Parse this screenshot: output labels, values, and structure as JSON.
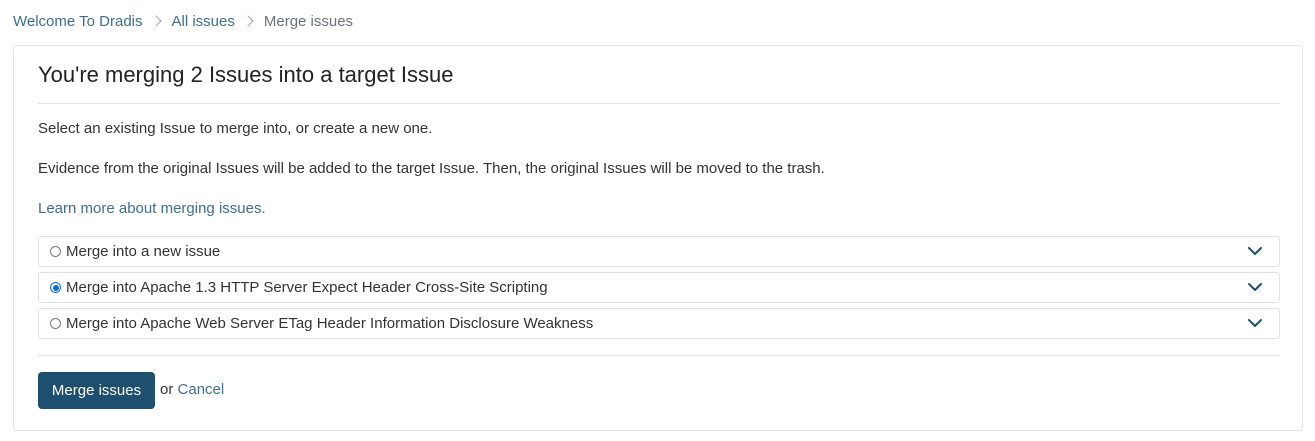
{
  "breadcrumb": {
    "items": [
      {
        "label": "Welcome To Dradis"
      },
      {
        "label": "All issues"
      }
    ],
    "current": "Merge issues"
  },
  "card": {
    "title": "You're merging 2 Issues into a target Issue",
    "instruction": "Select an existing Issue to merge into, or create a new one.",
    "evidence_note": "Evidence from the original Issues will be added to the target Issue. Then, the original Issues will be moved to the trash.",
    "learn_more_link": "Learn more about merging issues.",
    "options": [
      {
        "label": "Merge into a new issue",
        "selected": false
      },
      {
        "label": "Merge into Apache 1.3 HTTP Server Expect Header Cross-Site Scripting",
        "selected": true
      },
      {
        "label": "Merge into Apache Web Server ETag Header Information Disclosure Weakness",
        "selected": false
      }
    ],
    "submit_label": "Merge issues",
    "or_text": "or",
    "cancel_label": "Cancel"
  },
  "icons": {
    "breadcrumb_separator": "chevron-right-icon",
    "option_expand": "chevron-down-icon"
  },
  "colors": {
    "primary_button": "#1e4f6e",
    "link": "#3f6e8e",
    "radio_selected": "#0a6cda"
  }
}
